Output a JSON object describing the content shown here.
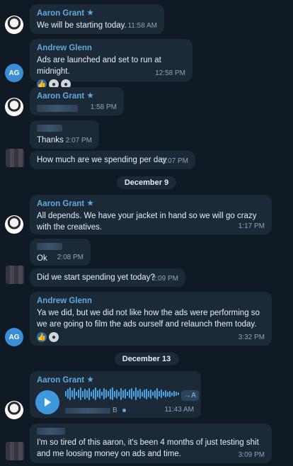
{
  "messages": [
    {
      "sender": "Aaron Grant",
      "text": "We will be starting today.",
      "time": "11:58 AM"
    },
    {
      "sender": "Andrew Glenn",
      "text": "Ads are launched and set to run at midnight.",
      "time": "12:58 PM"
    },
    {
      "sender": "Aaron Grant",
      "time": "1:58 PM"
    },
    {
      "text": "Thanks",
      "time": "2:07 PM"
    },
    {
      "text": "How much are we spending per day",
      "time": "2:07 PM"
    },
    {
      "sender": "Aaron Grant",
      "text": "All depends. We have your jacket in hand so we will go crazy with the creatives.",
      "time": "1:17 PM"
    },
    {
      "text": "Ok",
      "time": "2:08 PM"
    },
    {
      "text": "Did we start spending yet today?",
      "time": "2:09 PM"
    },
    {
      "sender": "Andrew Glenn",
      "text": "Ya we did, but we did not like how the ads were performing so we are going to film the ads ourself and relaunch them today.",
      "time": "3:32 PM"
    },
    {
      "sender": "Aaron Grant",
      "time": "11:43 AM",
      "voice_size_suffix": "B",
      "transcribe_label": "→A"
    },
    {
      "text": "I'm so tired of this aaron, it's been 4 months of just testing shit and me loosing money on ads and time.",
      "time": "3:09 PM"
    }
  ],
  "dates": [
    "December 9",
    "December 13"
  ],
  "avatar_initials": "AG",
  "icons": {
    "verified": "star-icon",
    "play": "play-icon",
    "thumb": "thumbs-up-icon"
  },
  "colors": {
    "background": "#0f1a24",
    "bubble": "#1c2a38",
    "accent": "#5fa9de"
  }
}
